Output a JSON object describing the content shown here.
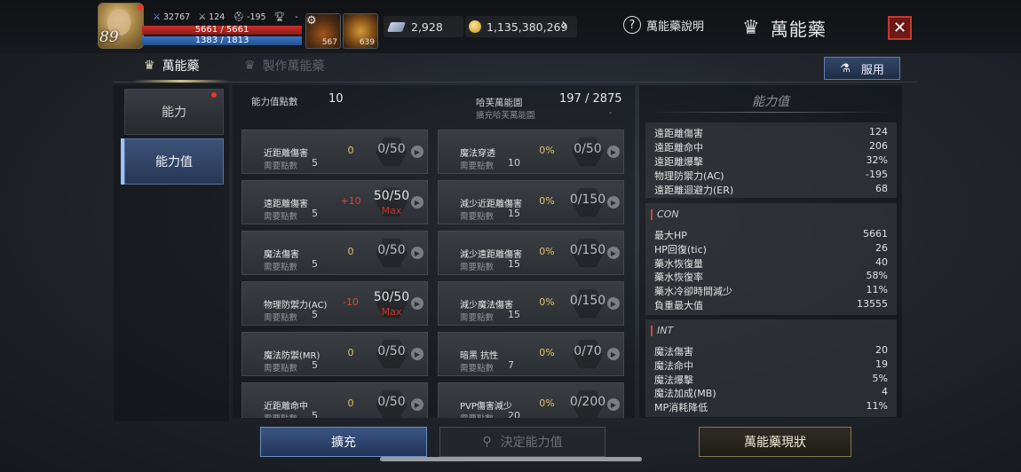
{
  "player": {
    "level": "89",
    "stat_power": "32767",
    "stat_attack": "124",
    "stat_defense": "-195",
    "stat_rank": "-",
    "hp": "5661 / 5661",
    "mp": "1383 / 1813"
  },
  "slots": [
    {
      "name": "potion-slot",
      "count": "567"
    },
    {
      "name": "feather-slot",
      "count": "639"
    }
  ],
  "currency": {
    "gems": "2,928",
    "gold": "1,135,380,269"
  },
  "header": {
    "help_label": "萬能藥說明",
    "title": "萬能藥",
    "close_glyph": "✕"
  },
  "tabs": [
    {
      "label": "萬能藥",
      "active": true
    },
    {
      "label": "製作萬能藥",
      "active": false
    }
  ],
  "use_button": "服用",
  "nav": [
    {
      "label": "能力",
      "active": false
    },
    {
      "label": "能力值",
      "active": true
    }
  ],
  "summary": {
    "points_label": "能力值點數",
    "points_value": "10",
    "herb_label": "哈芙萬能園",
    "herb_value": "197 / 2875",
    "herb_sub_label": "擴充哈芙萬能園",
    "herb_sub_value": "-"
  },
  "need_label": "需要點數",
  "left_cards": [
    {
      "name": "近距離傷害",
      "need": "5",
      "bonus": "0",
      "level": "0/50",
      "max": ""
    },
    {
      "name": "遠距離傷害",
      "need": "5",
      "bonus": "+10",
      "level": "50/50",
      "max": "Max"
    },
    {
      "name": "魔法傷害",
      "need": "5",
      "bonus": "0",
      "level": "0/50",
      "max": ""
    },
    {
      "name": "物理防禦力(AC)",
      "need": "5",
      "bonus": "-10",
      "level": "50/50",
      "max": "Max"
    },
    {
      "name": "魔法防禦(MR)",
      "need": "5",
      "bonus": "0",
      "level": "0/50",
      "max": ""
    },
    {
      "name": "近距離命中",
      "need": "5",
      "bonus": "0",
      "level": "0/50",
      "max": ""
    }
  ],
  "right_cards": [
    {
      "name": "魔法穿透",
      "need": "10",
      "bonus": "0%",
      "level": "0/50",
      "max": ""
    },
    {
      "name": "減少近距離傷害",
      "need": "15",
      "bonus": "0%",
      "level": "0/150",
      "max": ""
    },
    {
      "name": "減少遠距離傷害",
      "need": "15",
      "bonus": "0%",
      "level": "0/150",
      "max": ""
    },
    {
      "name": "減少魔法傷害",
      "need": "15",
      "bonus": "0%",
      "level": "0/150",
      "max": ""
    },
    {
      "name": "暗黑 抗性",
      "need": "7",
      "bonus": "0%",
      "level": "0/70",
      "max": ""
    },
    {
      "name": "PVP傷害減少",
      "need": "20",
      "bonus": "0%",
      "level": "0/200",
      "max": ""
    }
  ],
  "stats_panel": {
    "title": "能力值",
    "dex": [
      {
        "label": "遠距離傷害",
        "value": "124"
      },
      {
        "label": "遠距離命中",
        "value": "206"
      },
      {
        "label": "遠距離爆擊",
        "value": "32%"
      },
      {
        "label": "物理防禦力(AC)",
        "value": "-195"
      },
      {
        "label": "遠距離迴避力(ER)",
        "value": "68"
      }
    ],
    "con_title": "CON",
    "con": [
      {
        "label": "最大HP",
        "value": "5661"
      },
      {
        "label": "HP回復(tic)",
        "value": "26"
      },
      {
        "label": "藥水恢復量",
        "value": "40"
      },
      {
        "label": "藥水恢復率",
        "value": "58%"
      },
      {
        "label": "藥水冷卻時間減少",
        "value": "11%"
      },
      {
        "label": "負重最大值",
        "value": "13555"
      }
    ],
    "int_title": "INT",
    "int": [
      {
        "label": "魔法傷害",
        "value": "20"
      },
      {
        "label": "魔法命中",
        "value": "19"
      },
      {
        "label": "魔法爆擊",
        "value": "5%"
      },
      {
        "label": "魔法加成(MB)",
        "value": "4"
      },
      {
        "label": "MP消耗降低",
        "value": "11%"
      }
    ]
  },
  "bottom": {
    "expand": "擴充",
    "decide": "決定能力值",
    "status": "萬能藥現狀"
  }
}
